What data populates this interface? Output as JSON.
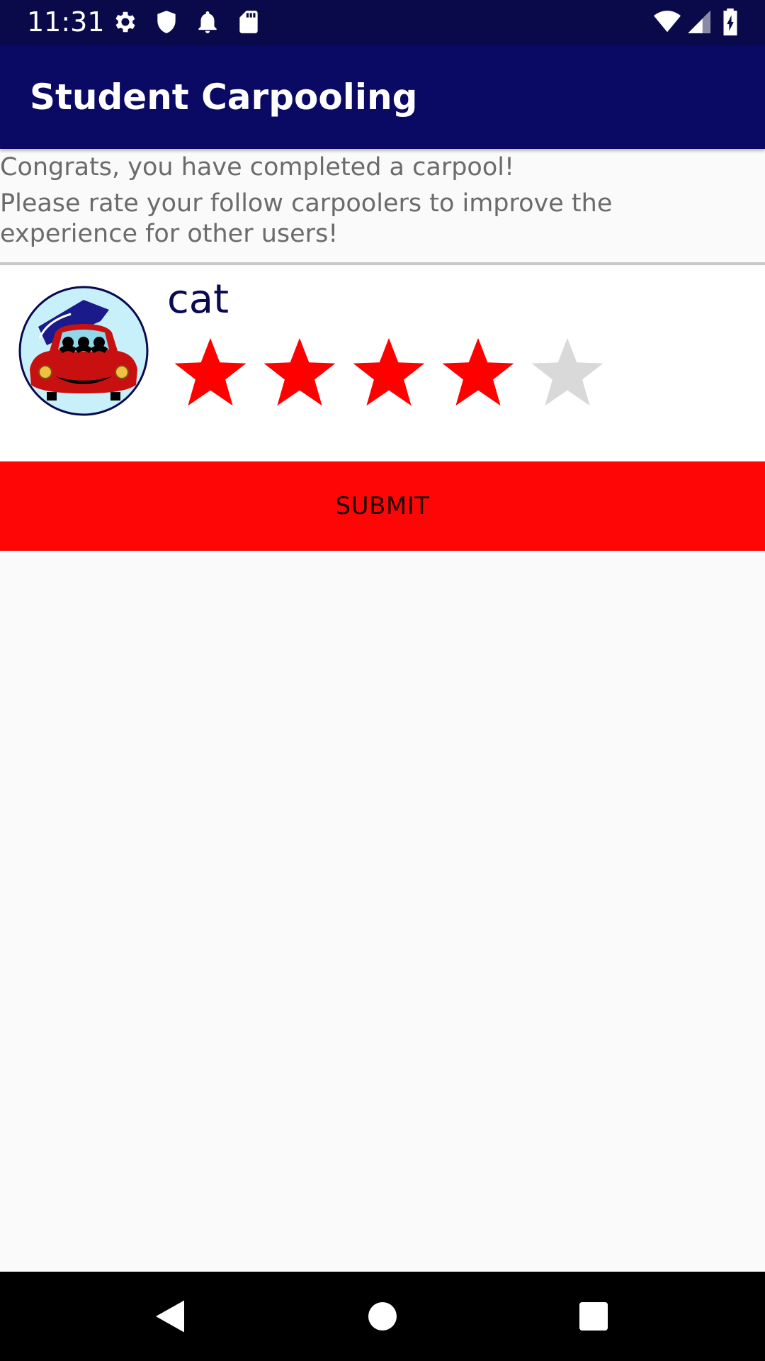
{
  "status_bar": {
    "time": "11:31",
    "left_icons": [
      "gear-icon",
      "shield-icon",
      "bell-icon",
      "sd-card-icon"
    ],
    "right_icons": [
      "wifi-icon",
      "signal-icon",
      "battery-charging-icon"
    ]
  },
  "app_bar": {
    "title": "Student Carpooling"
  },
  "intro": {
    "line1": "Congrats, you have completed a carpool!",
    "line2": "Please rate your follow carpoolers to improve the experience for other users!"
  },
  "ratings": [
    {
      "name": "cat",
      "avatar_icon": "carpool-car-icon",
      "rating": 4,
      "max_rating": 5
    }
  ],
  "colors": {
    "status_bar": "#0a0a4a",
    "app_bar": "#0a0a64",
    "star_filled": "#ff0000",
    "star_empty": "#d9d9d9",
    "submit_background": "#ff0606"
  },
  "submit": {
    "label": "SUBMIT"
  },
  "nav_bar": {
    "buttons": [
      "back-icon",
      "home-icon",
      "recents-icon"
    ]
  }
}
